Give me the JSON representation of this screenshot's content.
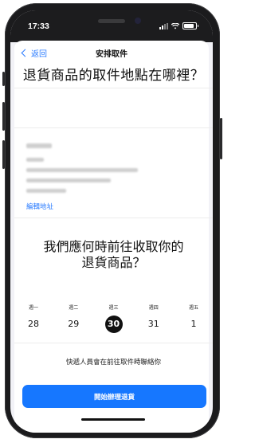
{
  "status_bar": {
    "time": "17:33"
  },
  "nav": {
    "back_label": "返回",
    "title": "安排取件"
  },
  "pickup_question": "退貨商品的取件地點在哪裡？",
  "address": {
    "edit_label": "編輯地址"
  },
  "time_question_line1": "我們應何時前往收取你的",
  "time_question_line2": "退貨商品？",
  "days": [
    {
      "weekday": "週一",
      "date": "28"
    },
    {
      "weekday": "週二",
      "date": "29"
    },
    {
      "weekday": "週三",
      "date": "30"
    },
    {
      "weekday": "週四",
      "date": "31"
    },
    {
      "weekday": "週五",
      "date": "1"
    }
  ],
  "selected_day_index": 2,
  "courier_note": "快遞人員會在前往取件時聯絡你",
  "cta_label": "開始辦理退貨",
  "colors": {
    "accent": "#1677ff",
    "link": "#2b7cff",
    "selected_day": "#111111"
  }
}
